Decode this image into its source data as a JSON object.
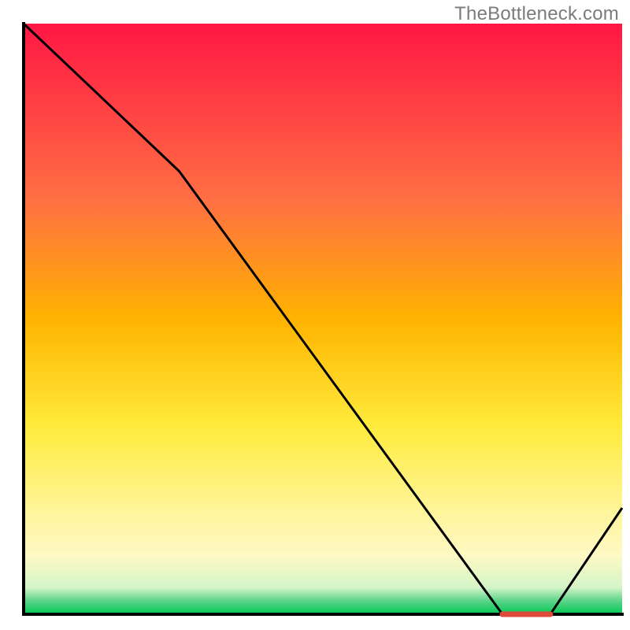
{
  "watermark": "TheBottleneck.com",
  "chart_data": {
    "type": "line",
    "title": "",
    "xlabel": "",
    "ylabel": "",
    "xlim": [
      0,
      100
    ],
    "ylim": [
      0,
      100
    ],
    "grid": false,
    "series": [
      {
        "name": "curve",
        "x": [
          0,
          26,
          80,
          88,
          100
        ],
        "y": [
          100,
          75,
          0,
          0,
          18
        ]
      }
    ],
    "marker": {
      "x_range": [
        80,
        88
      ],
      "y": 0
    },
    "gradient_stops": [
      {
        "offset": 0,
        "color": "#ff1744"
      },
      {
        "offset": 0.3,
        "color": "#ff7043"
      },
      {
        "offset": 0.5,
        "color": "#ffb300"
      },
      {
        "offset": 0.68,
        "color": "#ffeb3b"
      },
      {
        "offset": 0.83,
        "color": "#fff59d"
      },
      {
        "offset": 0.9,
        "color": "#fff9c4"
      },
      {
        "offset": 0.955,
        "color": "#d4f5c8"
      },
      {
        "offset": 0.975,
        "color": "#66d68f"
      },
      {
        "offset": 1.0,
        "color": "#00c853"
      }
    ]
  },
  "plot": {
    "margin_left": 30,
    "margin_top": 30,
    "margin_right": 10,
    "margin_bottom": 20,
    "axis_stroke": "#000000",
    "axis_width": 4,
    "curve_stroke": "#000000",
    "curve_width": 3,
    "marker_stroke": "#e04a3b",
    "marker_width": 7
  }
}
